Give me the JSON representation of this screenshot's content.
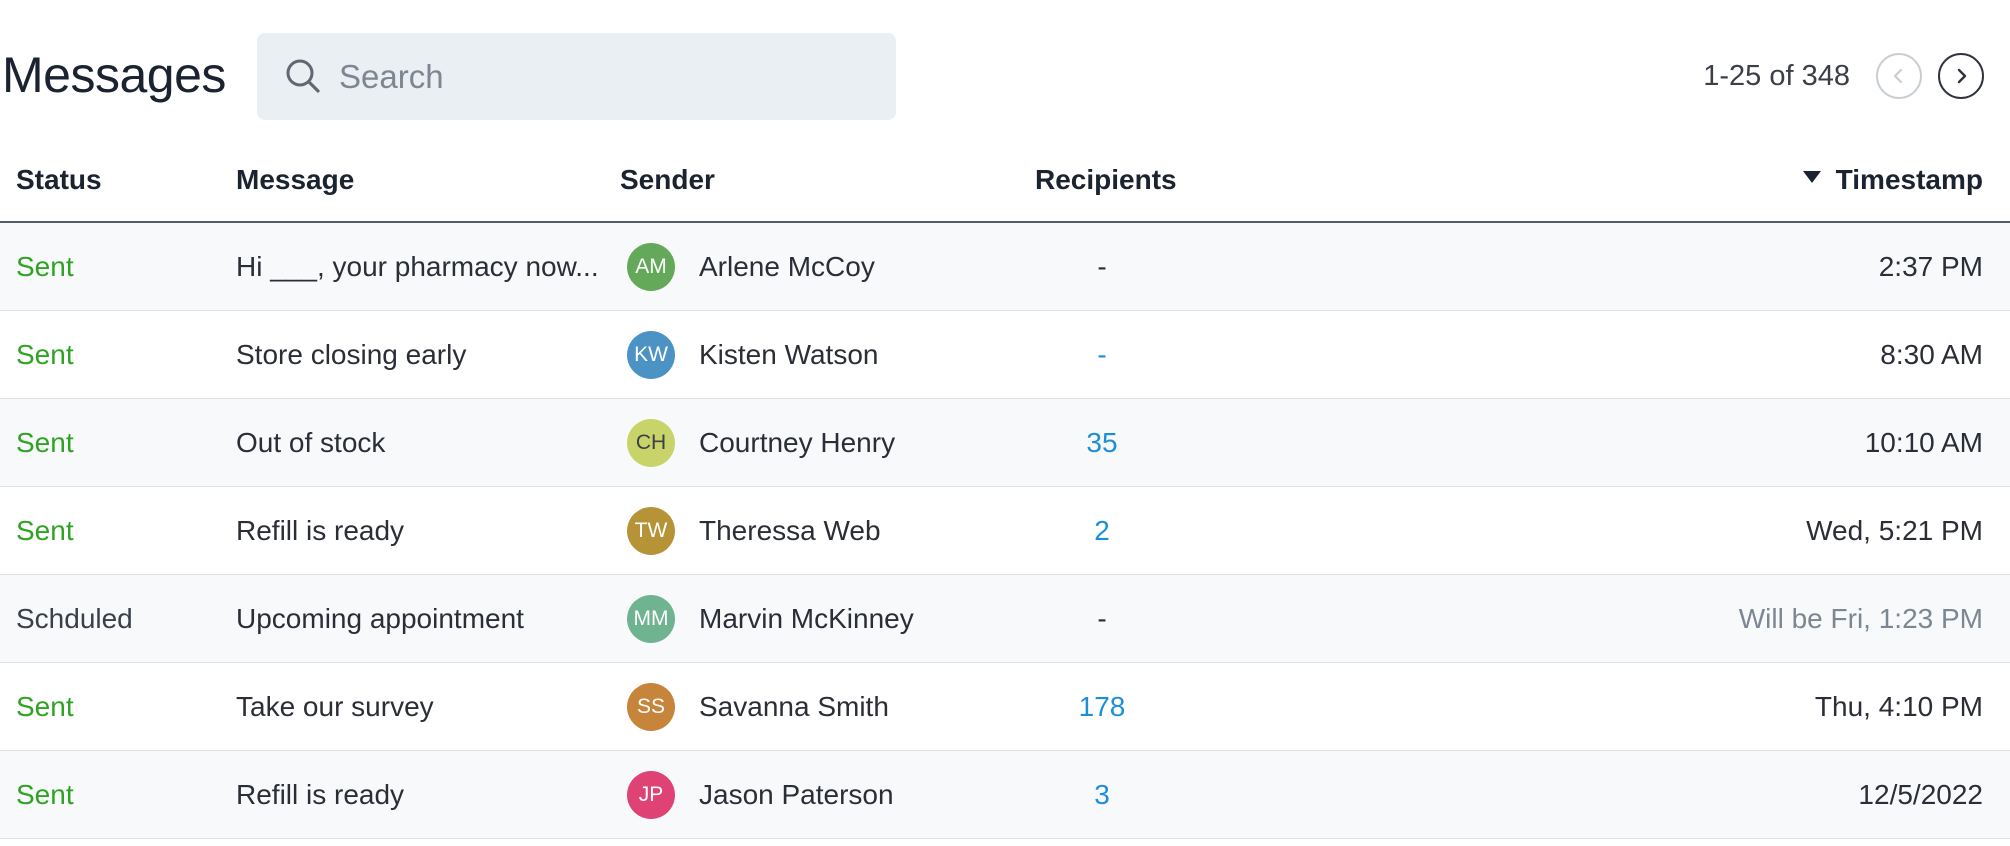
{
  "header": {
    "title": "Messages",
    "search": {
      "placeholder": "Search",
      "value": ""
    },
    "pagination": {
      "range_text": "1-25 of 348"
    }
  },
  "icons": {
    "search": "search-icon",
    "prev": "chevron-left-icon",
    "next": "chevron-right-icon",
    "sort": "sort-descending-icon"
  },
  "colors": {
    "sent": "#2fa422",
    "link": "#1e8fd6",
    "muted": "#7d8791"
  },
  "table": {
    "columns": {
      "status": "Status",
      "message": "Message",
      "sender": "Sender",
      "recipients": "Recipients",
      "timestamp": "Timestamp"
    },
    "rows": [
      {
        "status": "Sent",
        "message": "Hi ___, your pharmacy now...",
        "sender_initials": "AM",
        "sender_name": "Arlene McCoy",
        "avatar_color": "#64a95a",
        "recipients": "-",
        "timestamp": "2:37 PM"
      },
      {
        "status": "Sent",
        "message": "Store closing early",
        "sender_initials": "KW",
        "sender_name": "Kisten Watson",
        "avatar_color": "#4b93c5",
        "recipients": "-",
        "timestamp": "8:30 AM"
      },
      {
        "status": "Sent",
        "message": "Out of stock",
        "sender_initials": "CH",
        "sender_name": "Courtney Henry",
        "avatar_color": "#c8d46a",
        "recipients": "35",
        "timestamp": "10:10 AM"
      },
      {
        "status": "Sent",
        "message": "Refill is ready",
        "sender_initials": "TW",
        "sender_name": "Theressa Web",
        "avatar_color": "#b59336",
        "recipients": "2",
        "timestamp": "Wed, 5:21 PM"
      },
      {
        "status": "Schduled",
        "message": "Upcoming appointment",
        "sender_initials": "MM",
        "sender_name": "Marvin McKinney",
        "avatar_color": "#6fb390",
        "recipients": "-",
        "timestamp": "Will be Fri, 1:23 PM"
      },
      {
        "status": "Sent",
        "message": "Take our survey",
        "sender_initials": "SS",
        "sender_name": "Savanna Smith",
        "avatar_color": "#c7853b",
        "recipients": "178",
        "timestamp": "Thu, 4:10 PM"
      },
      {
        "status": "Sent",
        "message": "Refill is ready",
        "sender_initials": "JP",
        "sender_name": "Jason Paterson",
        "avatar_color": "#df4375",
        "recipients": "3",
        "timestamp": "12/5/2022"
      }
    ]
  }
}
